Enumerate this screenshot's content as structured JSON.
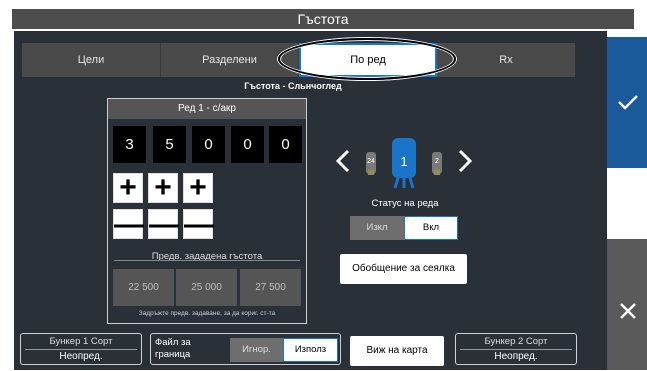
{
  "window": {
    "title": "Гъстота"
  },
  "tabs": [
    {
      "label": "Цели",
      "active": false
    },
    {
      "label": "Разделени",
      "active": false
    },
    {
      "label": "По ред",
      "active": true
    },
    {
      "label": "Rx",
      "active": false
    }
  ],
  "subtitle": "Гъстота - Сльнчоглед",
  "row_rate": {
    "header": "Ред 1 - с/акр",
    "digits": [
      "3",
      "5",
      "0",
      "0",
      "0"
    ],
    "increment_symbol": "+",
    "decrement_symbol": "—",
    "preset_label": "Предв. зададена гъстота",
    "presets": [
      "22 500",
      "25 000",
      "27 500"
    ],
    "preset_hint": "Задръжте предв. задаване, за да кориг. ст-та"
  },
  "row_selector": {
    "prev_row": "24",
    "current_row": "1",
    "next_row": "2",
    "accent_color": "#1a74c8"
  },
  "row_status": {
    "label": "Статус на реда",
    "off_label": "Изкл",
    "on_label": "Вкл",
    "value": "Вкл"
  },
  "planting_summary_button": "Обобщение за сеялка",
  "bunker1": {
    "label": "Бункер 1 Сорт",
    "value": "Неопред."
  },
  "boundary_file": {
    "label": "Файл за граница",
    "ignore_label": "Игнор.",
    "use_label": "Използ",
    "value": "Използ"
  },
  "map_button": "Виж на карта",
  "bunker2": {
    "label": "Бункер 2 Сорт",
    "value": "Неопред."
  },
  "actions": {
    "ok_icon": "checkmark-icon",
    "cancel_icon": "close-icon"
  }
}
